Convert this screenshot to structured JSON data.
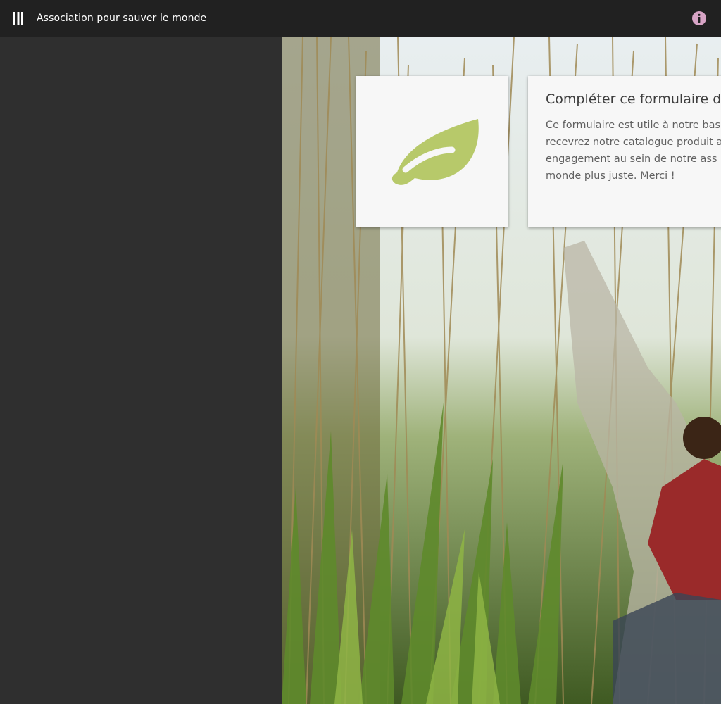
{
  "header": {
    "title": "Association pour sauver le monde",
    "menu_icon": "menu-bars-icon",
    "info_icon": "info-icon",
    "info_color": "#d7a4c5"
  },
  "card": {
    "icon": "leaf-icon",
    "icon_color": "#b7c96a",
    "title": "Compléter ce formulaire de c",
    "lines": [
      "Ce formulaire est utile à notre bas",
      "recevrez notre catalogue produit ai",
      "engagement au sein de notre ass",
      "monde plus juste. Merci !"
    ]
  }
}
